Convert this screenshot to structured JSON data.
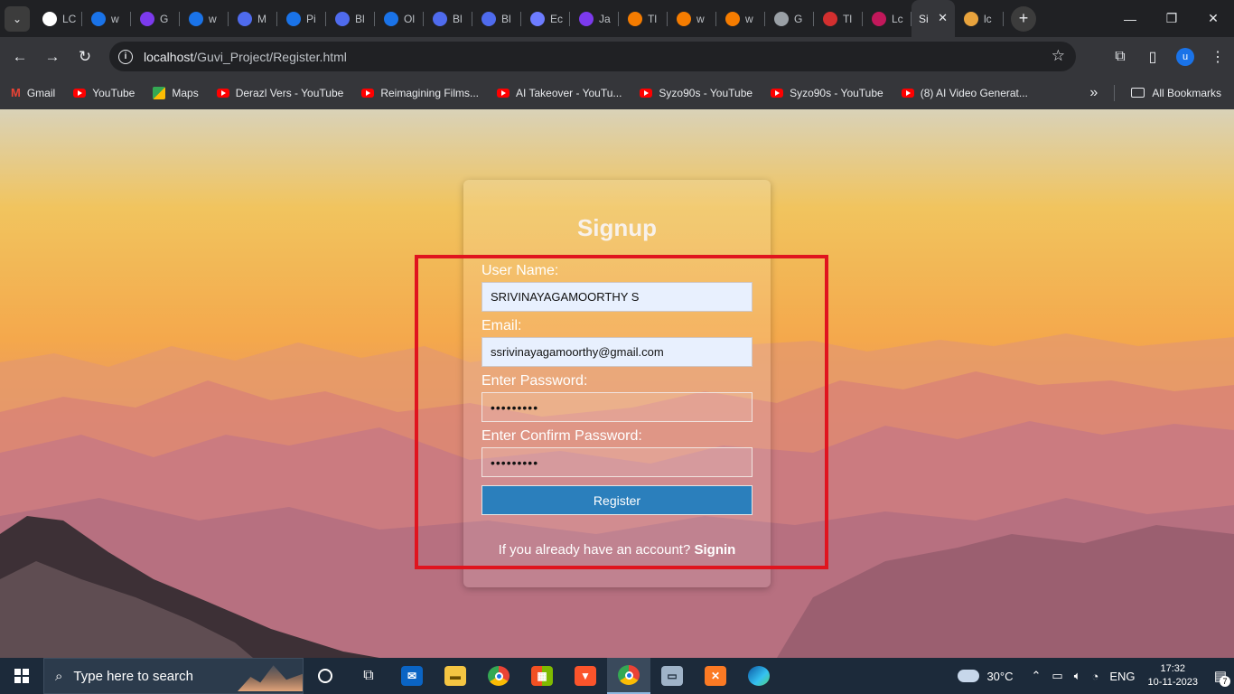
{
  "browser": {
    "tabs": [
      {
        "short": "LC",
        "color": "#ffffff",
        "icon": "globe-icon"
      },
      {
        "short": "w",
        "color": "#1a73e8",
        "icon": "c-icon"
      },
      {
        "short": "G",
        "color": "#7c3aed",
        "icon": "b-icon"
      },
      {
        "short": "w",
        "color": "#1a73e8",
        "icon": "c-icon"
      },
      {
        "short": "M",
        "color": "#4f6bed",
        "icon": "doc-icon"
      },
      {
        "short": "Pi",
        "color": "#1a73e8",
        "icon": "c-icon"
      },
      {
        "short": "Bl",
        "color": "#4f6bed",
        "icon": "doc-icon"
      },
      {
        "short": "Ol",
        "color": "#1a73e8",
        "icon": "c-icon"
      },
      {
        "short": "Bl",
        "color": "#4f6bed",
        "icon": "doc-icon"
      },
      {
        "short": "Bl",
        "color": "#4f6bed",
        "icon": "doc-icon"
      },
      {
        "short": "Ec",
        "color": "#6d7cff",
        "icon": "wave-icon"
      },
      {
        "short": "Ja",
        "color": "#7c3aed",
        "icon": "j-icon"
      },
      {
        "short": "Tl",
        "color": "#f57c00",
        "icon": "tl-icon"
      },
      {
        "short": "w",
        "color": "#f57c00",
        "icon": "tl-icon"
      },
      {
        "short": "w",
        "color": "#f57c00",
        "icon": "tl-icon"
      },
      {
        "short": "G",
        "color": "#9aa0a6",
        "icon": "globe-icon"
      },
      {
        "short": "Tl",
        "color": "#d32f2f",
        "icon": "hd-icon"
      },
      {
        "short": "Lc",
        "color": "#c2185b",
        "icon": "nc-icon"
      },
      {
        "short": "lc",
        "color": "#e8a33d",
        "icon": "mountain-icon"
      }
    ],
    "active_tab": {
      "short": "Si",
      "close": "✕"
    },
    "new_tab": "+",
    "url_host": "localhost",
    "url_path": "/Guvi_Project/Register.html",
    "profile_initial": "u",
    "bookmarks": [
      {
        "label": "Gmail",
        "icon": "gmail-icon"
      },
      {
        "label": "YouTube",
        "icon": "youtube-icon"
      },
      {
        "label": "Maps",
        "icon": "maps-icon"
      },
      {
        "label": "Derazl Vers - YouTube",
        "icon": "youtube-icon"
      },
      {
        "label": "Reimagining Films...",
        "icon": "youtube-icon"
      },
      {
        "label": "AI Takeover - YouTu...",
        "icon": "youtube-icon"
      },
      {
        "label": "Syzo90s - YouTube",
        "icon": "youtube-icon"
      },
      {
        "label": "Syzo90s - YouTube",
        "icon": "youtube-icon"
      },
      {
        "label": "(8) AI Video Generat...",
        "icon": "youtube-icon"
      }
    ],
    "bookmarks_overflow": "»",
    "all_bookmarks": "All Bookmarks"
  },
  "form": {
    "title": "Signup",
    "username_label": "User Name:",
    "username_value": "SRIVINAYAGAMOORTHY S",
    "email_label": "Email:",
    "email_value": "ssrivinayagamoorthy@gmail.com",
    "password_label": "Enter Password:",
    "password_value": "•••••••••",
    "confirm_label": "Enter Confirm Password:",
    "confirm_value": "•••••••••",
    "register_label": "Register",
    "footer_text": "If you already have an account?",
    "signin_label": "Signin"
  },
  "annotation": {
    "highlight_color": "#e0141e"
  },
  "taskbar": {
    "search_placeholder": "Type here to search",
    "apps": [
      "cortana-icon",
      "task-view-icon",
      "mail-icon",
      "file-explorer-icon",
      "chrome-icon",
      "store-icon",
      "brave-icon",
      "chrome-profile-icon",
      "remote-desktop-icon",
      "xampp-icon",
      "edge-icon"
    ],
    "weather": "30°C",
    "language": "ENG",
    "time": "17:32",
    "date": "10-11-2023",
    "notifications": "7"
  }
}
